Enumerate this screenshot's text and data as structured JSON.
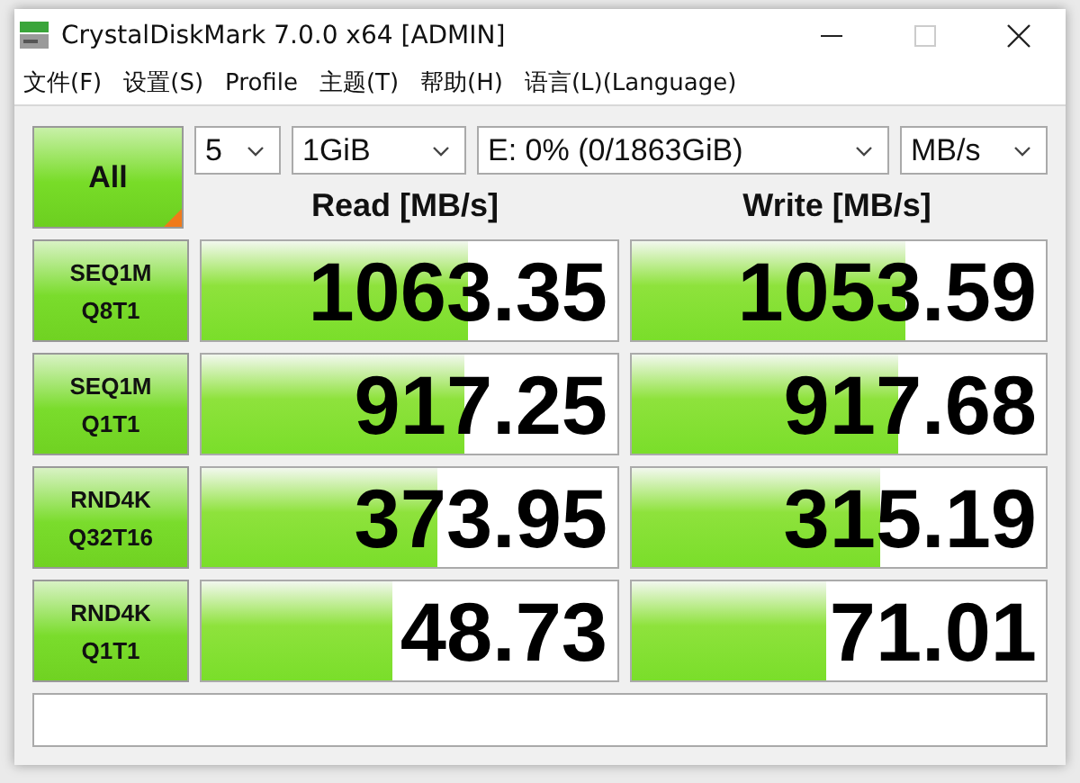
{
  "window": {
    "title": "CrystalDiskMark 7.0.0 x64 [ADMIN]"
  },
  "menu": [
    "文件(F)",
    "设置(S)",
    "Profile",
    "主题(T)",
    "帮助(H)",
    "语言(L)(Language)"
  ],
  "all_button": {
    "label": "All"
  },
  "selectors": [
    {
      "value": "5"
    },
    {
      "value": "1GiB"
    },
    {
      "value": "E: 0% (0/1863GiB)"
    },
    {
      "value": "MB/s"
    }
  ],
  "columns": [
    "Read [MB/s]",
    "Write [MB/s]"
  ],
  "tests": [
    {
      "line1": "SEQ1M",
      "line2": "Q8T1",
      "read": {
        "value": "1063.35",
        "level": 0.64
      },
      "write": {
        "value": "1053.59",
        "level": 0.66
      }
    },
    {
      "line1": "SEQ1M",
      "line2": "Q1T1",
      "read": {
        "value": "917.25",
        "level": 0.635
      },
      "write": {
        "value": "917.68",
        "level": 0.645
      }
    },
    {
      "line1": "RND4K",
      "line2": "Q32T16",
      "read": {
        "value": "373.95",
        "level": 0.57
      },
      "write": {
        "value": "315.19",
        "level": 0.6
      }
    },
    {
      "line1": "RND4K",
      "line2": "Q1T1",
      "read": {
        "value": "48.73",
        "level": 0.46
      },
      "write": {
        "value": "71.01",
        "level": 0.47
      }
    }
  ]
}
